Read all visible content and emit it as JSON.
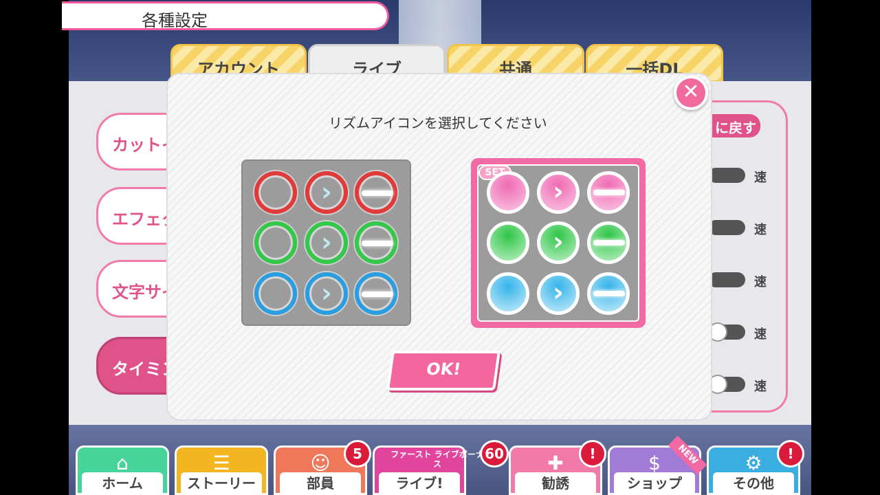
{
  "header": {
    "title": "各種設定"
  },
  "tabs": [
    {
      "label": "アカウント",
      "active": false
    },
    {
      "label": "ライブ",
      "active": true
    },
    {
      "label": "共通",
      "active": false
    },
    {
      "label": "一括DL",
      "active": false
    }
  ],
  "background_panel": {
    "side_buttons": [
      "カットイ",
      "エフェク",
      "文字サイ",
      "タイミン"
    ],
    "back_button": "に戻す",
    "speed_label": "速"
  },
  "modal": {
    "title": "リズムアイコンを選択してください",
    "set_badge": "SET",
    "ok_label": "OK!",
    "close_icon": "close-icon",
    "colors": {
      "red": "#e03a3a",
      "green": "#33c84a",
      "blue": "#2a9ee0",
      "pink": "#f06ab4"
    }
  },
  "nav": {
    "items": [
      {
        "label": "ホーム",
        "icon": "home-icon",
        "color": "#46d49a"
      },
      {
        "label": "ストーリー",
        "icon": "story-icon",
        "color": "#f4b620"
      },
      {
        "label": "部員",
        "icon": "members-icon",
        "color": "#f0785a",
        "badge": "5"
      },
      {
        "label": "ライブ!",
        "icon": "live-icon",
        "color": "#e0449c",
        "badge": "60",
        "banner": "ファースト ライブボーナス"
      },
      {
        "label": "勧誘",
        "icon": "scout-icon",
        "color": "#f27aa8",
        "badge": "!"
      },
      {
        "label": "ショップ",
        "icon": "shop-icon",
        "color": "#a27ad8",
        "tag": "NEW"
      },
      {
        "label": "その他",
        "icon": "gear-icon",
        "color": "#3aaee0",
        "badge": "!"
      }
    ]
  }
}
